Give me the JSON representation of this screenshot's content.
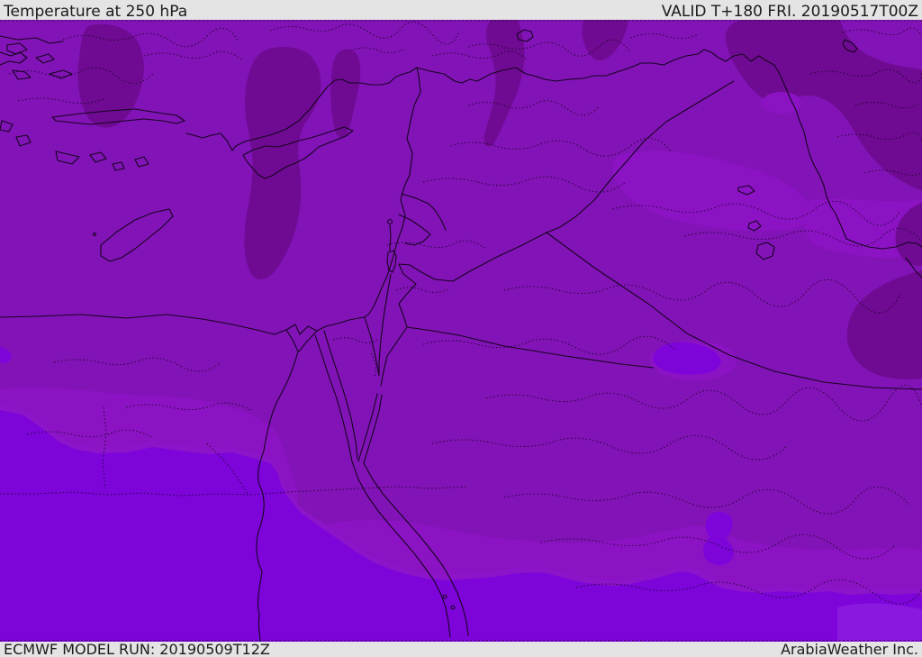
{
  "header": {
    "title": "Temperature at 250 hPa",
    "valid": "VALID T+180 FRI. 20190517T00Z"
  },
  "footer": {
    "model_run": "ECMWF MODEL RUN: 20190509T12Z",
    "credit": "ArabiaWeather Inc."
  },
  "map": {
    "parameter": "Temperature at 250 hPa",
    "style": "filled temperature shading with coastlines, country borders and dotted admin boundaries"
  },
  "colors": {
    "bar_bg": "#e4e4e4",
    "bar_text": "#1b1b1b",
    "temp_base": "#8213b7",
    "temp_dark": "#6f0b92",
    "temp_light": "#8c13c4",
    "temp_violet": "#7d05da",
    "temp_violet_fringe": "#8c15c9",
    "temp_violet_light": "#8a18df",
    "line": "#16041f"
  }
}
